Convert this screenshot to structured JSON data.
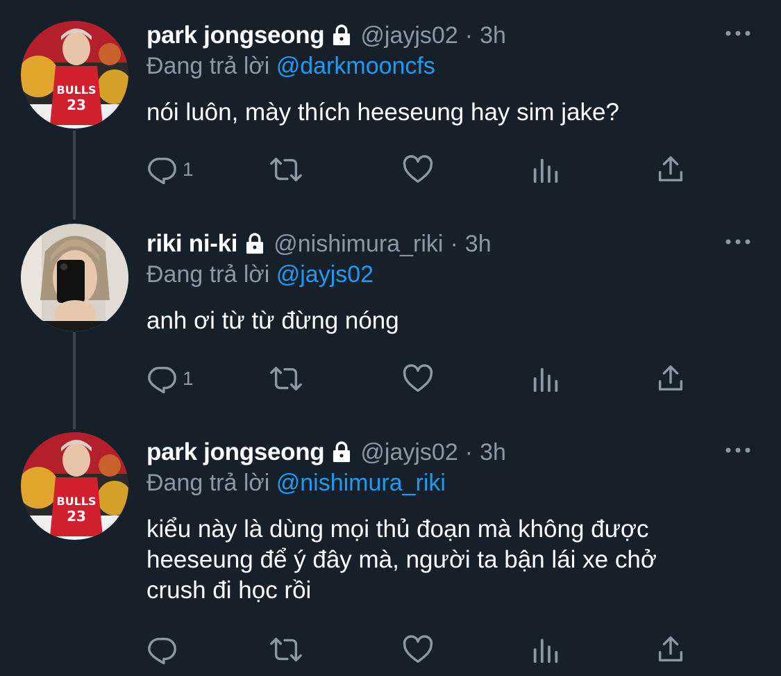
{
  "tweets": [
    {
      "name": "park jongseong",
      "handle": "@jayjs02",
      "time": "3h",
      "replying_prefix": "Đang trả lời",
      "replying_to": "@darkmooncfs",
      "text_lines": [
        "nói luôn, mày thích heeseung hay sim jake?"
      ],
      "reply_count": "1",
      "avatar": "jersey-avatar"
    },
    {
      "name": "riki ni-ki",
      "handle": "@nishimura_riki",
      "time": "3h",
      "replying_prefix": "Đang trả lời",
      "replying_to": "@jayjs02",
      "text_lines": [
        "anh ơi từ từ đừng nóng"
      ],
      "reply_count": "1",
      "avatar": "selfie-avatar"
    },
    {
      "name": "park jongseong",
      "handle": "@jayjs02",
      "time": "3h",
      "replying_prefix": "Đang trả lời",
      "replying_to": "@nishimura_riki",
      "text_lines": [
        "kiểu này là dùng mọi thủ đoạn mà không được",
        "heeseung để ý đây mà, người ta bận lái xe chở",
        "crush đi học rồi"
      ],
      "reply_count": "",
      "avatar": "jersey-avatar"
    }
  ],
  "separator": "·",
  "colors": {
    "background": "#15202b",
    "muted": "#8b98a5",
    "link": "#1d9bf0",
    "thread_line": "#38444d"
  }
}
